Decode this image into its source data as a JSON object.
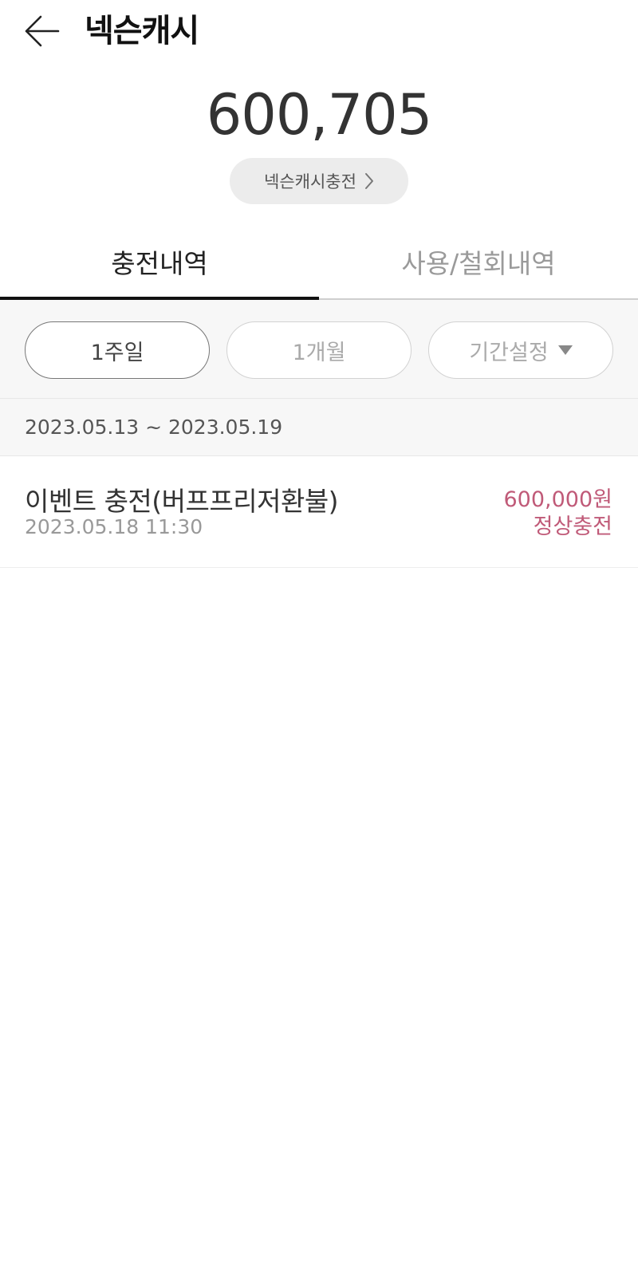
{
  "header": {
    "back_icon": "arrow-left-icon",
    "title": "넥슨캐시"
  },
  "balance": {
    "amount": "600,705"
  },
  "charge_button": {
    "label": "넥슨캐시충전",
    "icon": "chevron-right-icon"
  },
  "tabs": [
    {
      "label": "충전내역",
      "active": true
    },
    {
      "label": "사용/철회내역",
      "active": false
    }
  ],
  "filters": [
    {
      "label": "1주일",
      "selected": true
    },
    {
      "label": "1개월",
      "selected": false
    },
    {
      "label": "기간설정",
      "selected": false,
      "icon": "caret-down-icon"
    }
  ],
  "date_range": "2023.05.13 ~ 2023.05.19",
  "transactions": [
    {
      "title": "이벤트 충전(버프프리저환불)",
      "datetime": "2023.05.18 11:30",
      "amount": "600,000원",
      "status": "정상충전"
    }
  ],
  "colors": {
    "accent_amount": "#c05a78",
    "tab_indicator": "#111111",
    "pill_background": "#ececec"
  }
}
